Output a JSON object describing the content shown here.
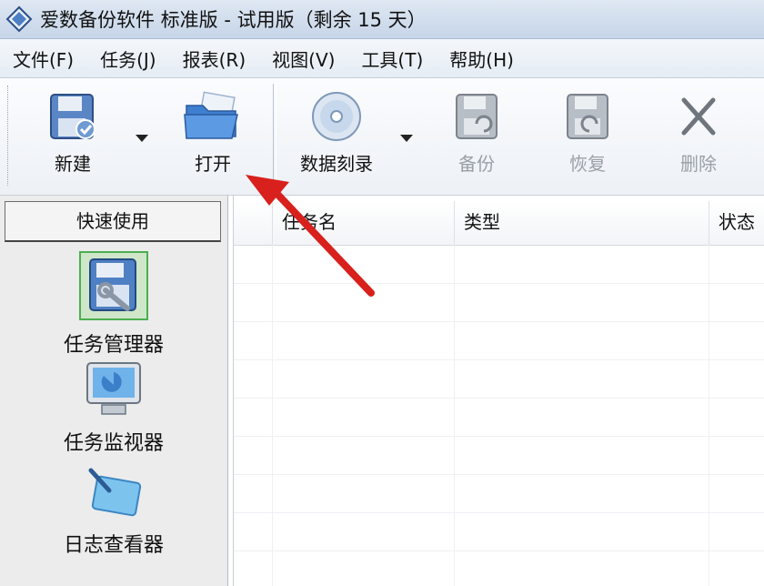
{
  "window": {
    "title": "爱数备份软件 标准版 - 试用版（剩余 15 天）",
    "icon": "app-diamond-icon"
  },
  "menu": [
    "文件(F)",
    "任务(J)",
    "报表(R)",
    "视图(V)",
    "工具(T)",
    "帮助(H)"
  ],
  "toolbar": {
    "new": {
      "label": "新建",
      "icon": "floppy-disk-new-icon",
      "has_dropdown": true
    },
    "open": {
      "label": "打开",
      "icon": "open-folder-icon"
    },
    "burn": {
      "label": "数据刻录",
      "icon": "disc-icon",
      "has_dropdown": true
    },
    "backup": {
      "label": "备份",
      "icon": "backup-disk-icon",
      "disabled": true
    },
    "restore": {
      "label": "恢复",
      "icon": "restore-disk-icon",
      "disabled": true
    },
    "delete": {
      "label": "删除",
      "icon": "delete-x-icon",
      "disabled": true
    }
  },
  "quick_panel": {
    "title": "快速使用",
    "items": [
      {
        "label": "任务管理器",
        "icon": "task-manager-icon",
        "selected": true
      },
      {
        "label": "任务监视器",
        "icon": "monitor-icon"
      },
      {
        "label": "日志查看器",
        "icon": "log-viewer-icon"
      }
    ]
  },
  "task_table": {
    "columns": [
      "任务名",
      "类型",
      "状态"
    ],
    "rows": []
  },
  "annotation": {
    "type": "red-arrow",
    "points_to": "open-button",
    "color": "#d8201c"
  },
  "colors": {
    "accent": "#3a78c9",
    "selection_border": "#4caf50",
    "arrow": "#d8201c"
  }
}
